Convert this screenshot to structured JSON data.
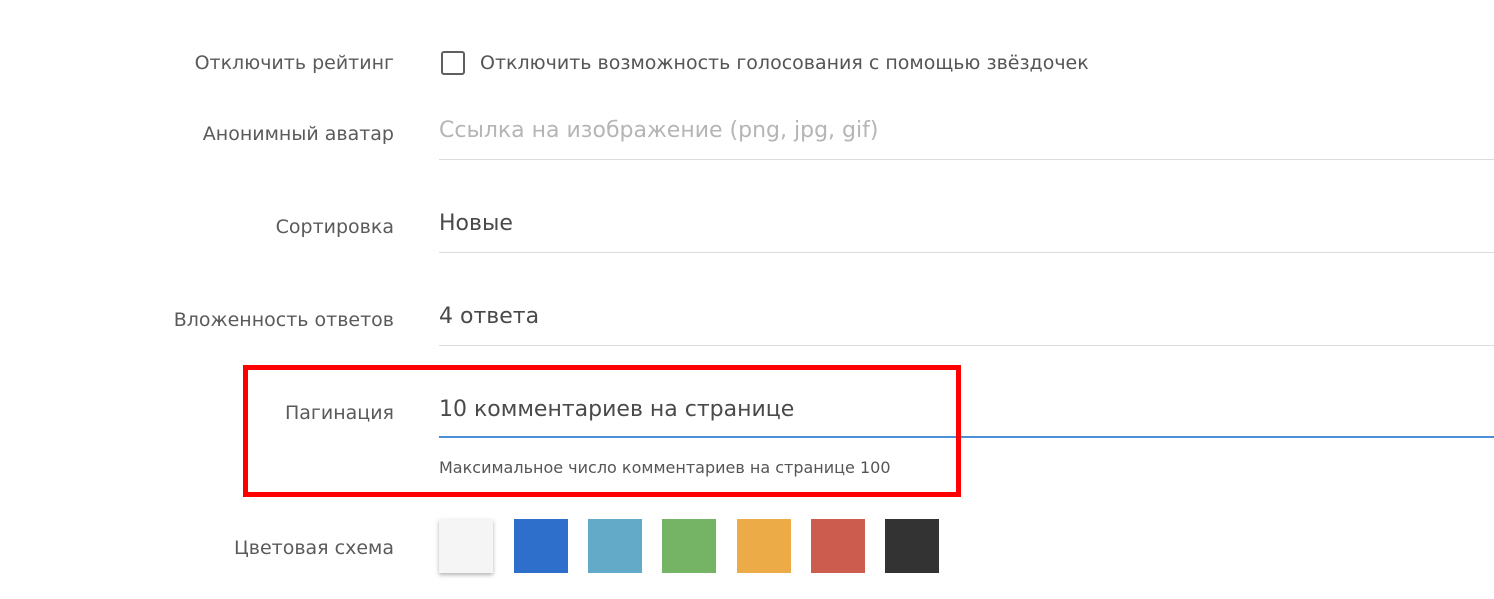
{
  "rating": {
    "label": "Отключить рейтинг",
    "checkbox_label": "Отключить возможность голосования с помощью звёздочек",
    "checked": false
  },
  "avatar": {
    "label": "Анонимный аватар",
    "placeholder": "Ссылка на изображение (png, jpg, gif)"
  },
  "sorting": {
    "label": "Сортировка",
    "value": "Новые"
  },
  "nesting": {
    "label": "Вложенность ответов",
    "value": "4 ответа"
  },
  "pagination": {
    "label": "Пагинация",
    "value": "10 комментариев на странице",
    "hint": "Максимальное число комментариев на странице 100"
  },
  "color_scheme": {
    "label": "Цветовая схема",
    "swatches": [
      "#f5f5f5",
      "#2d6fcb",
      "#62aac8",
      "#74b464",
      "#edab48",
      "#cc5d4e",
      "#333333"
    ]
  },
  "colors": {
    "accent_underline": "#4a90d9",
    "highlight_border": "#ff0000"
  }
}
